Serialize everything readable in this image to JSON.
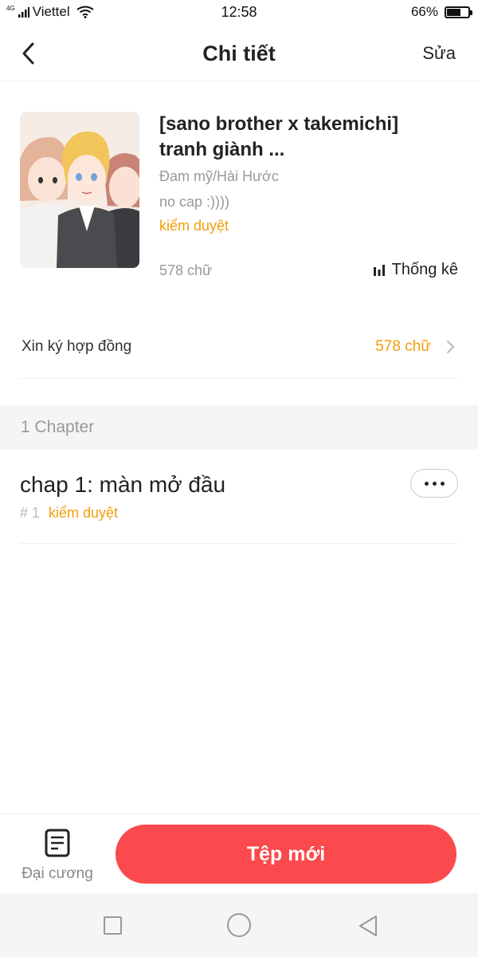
{
  "status_bar": {
    "network": "4G",
    "carrier": "Viettel",
    "time": "12:58",
    "battery_percent": "66%",
    "battery_level": 0.66
  },
  "header": {
    "title": "Chi tiết",
    "edit_label": "Sửa"
  },
  "book": {
    "title": "[sano brother x takemichi] tranh giành ...",
    "genre": "Đam mỹ/Hài Hước",
    "description": "no cap :))))",
    "status": "kiểm duyệt",
    "word_count": "578 chữ",
    "stats_label": "Thống kê"
  },
  "contract": {
    "label": "Xin ký hợp đồng",
    "value": "578 chữ"
  },
  "chapters": {
    "count_label": "1 Chapter",
    "items": [
      {
        "title": "chap 1: màn mở đầu",
        "number": "# 1",
        "status": "kiểm duyệt"
      }
    ]
  },
  "bottom_bar": {
    "outline_label": "Đại cương",
    "new_file_label": "Tệp mới"
  },
  "colors": {
    "accent_orange": "#f29d0a",
    "primary_red": "#fb4a4d"
  },
  "icons": [
    "back-icon",
    "wifi-icon",
    "signal-icon",
    "battery-icon",
    "stats-icon",
    "chevron-right-icon",
    "more-icon",
    "outline-icon",
    "nav-recents-icon",
    "nav-home-icon",
    "nav-back-icon"
  ]
}
